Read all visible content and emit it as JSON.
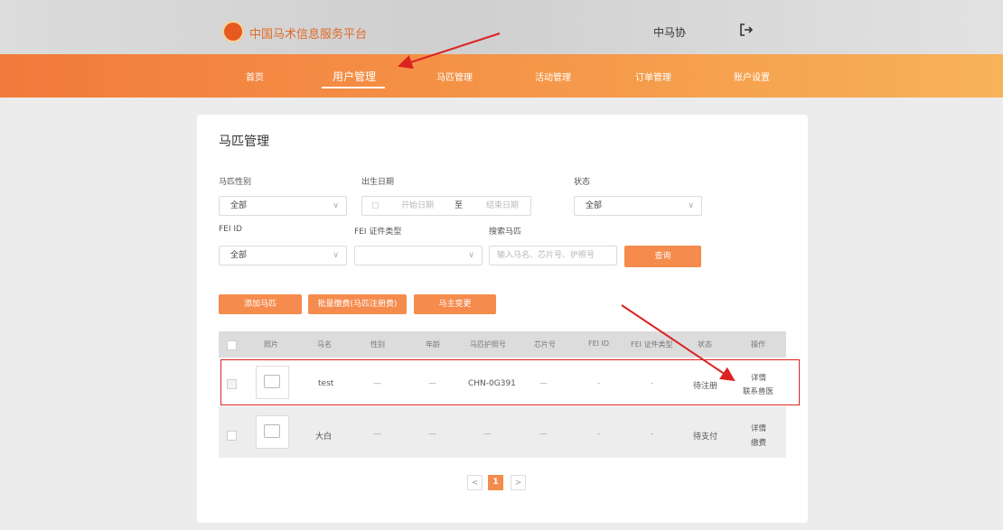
{
  "header": {
    "site_title": "中国马术信息服务平台",
    "user_name": "中马协"
  },
  "nav": {
    "items": [
      "首页",
      "用户管理",
      "马匹管理",
      "活动管理",
      "订单管理",
      "账户设置"
    ],
    "active": "用户管理"
  },
  "page": {
    "title": "马匹管理"
  },
  "filters": {
    "gender_label": "马匹性别",
    "gender_value": "全部",
    "birth_label": "出生日期",
    "start_placeholder": "开始日期",
    "range_sep": "至",
    "end_placeholder": "结束日期",
    "status_label": "状态",
    "status_value": "全部",
    "fei_id_label": "FEI ID",
    "fei_id_value": "全部",
    "fei_type_label": "FEI 证件类型",
    "fei_type_value": "",
    "search_label": "搜索马匹",
    "search_placeholder": "输入马名、芯片号、护照号",
    "query_button": "查询"
  },
  "actions": {
    "add_horse": "添加马匹",
    "batch_pay": "批量缴费(马匹注册费)",
    "owner_change": "马主变更"
  },
  "table": {
    "columns": [
      "照片",
      "马名",
      "性别",
      "年龄",
      "马匹护照号",
      "芯片号",
      "FEI ID",
      "FEI 证件类型",
      "状态",
      "操作"
    ],
    "rows": [
      {
        "name": "test",
        "gender": "—",
        "age": "—",
        "passport": "CHN-0G391",
        "chip": "—",
        "fei_id": "-",
        "fei_type": "-",
        "status": "待注册",
        "actions": [
          "详情",
          "联系兽医"
        ]
      },
      {
        "name": "大白",
        "gender": "—",
        "age": "—",
        "passport": "—",
        "chip": "—",
        "fei_id": "-",
        "fei_type": "-",
        "status": "待支付",
        "actions": [
          "详情",
          "缴费"
        ]
      }
    ]
  },
  "pagination": {
    "prev": "<",
    "current": "1",
    "next": ">"
  },
  "colors": {
    "accent": "#f58b4c",
    "highlight": "#dd2222"
  },
  "icons": [
    "logo-icon",
    "logout-icon",
    "calendar-icon",
    "chevron-down-icon",
    "image-placeholder-icon",
    "annotation-arrow"
  ]
}
